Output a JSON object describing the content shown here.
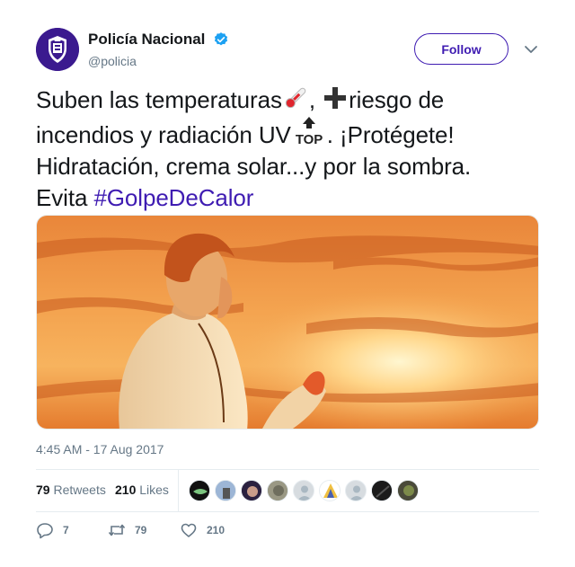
{
  "author": {
    "display_name": "Policía Nacional",
    "handle": "@policia",
    "verified": true
  },
  "follow_label": "Follow",
  "tweet": {
    "line1_a": "Suben las temperaturas",
    "line1_b": ", ",
    "line1_c": "riesgo de",
    "line2_a": "incendios y radiación UV",
    "line2_b": ". ¡Protégete!",
    "line3": "Hidratación, crema solar...y por la sombra.",
    "line4_a": "Evita ",
    "hashtag": "#GolpeDeCalor",
    "emoji": [
      "thermometer-emoji",
      "plus-emoji",
      "top-emoji"
    ]
  },
  "timestamp": "4:45 AM - 17 Aug 2017",
  "stats": {
    "retweets_count": "79",
    "retweets_label": "Retweets",
    "likes_count": "210",
    "likes_label": "Likes"
  },
  "actions": {
    "reply_count": "7",
    "retweet_count": "79",
    "like_count": "210"
  },
  "colors": {
    "brand": "#3f1cb2",
    "verified": "#1da1f2",
    "muted": "#657786",
    "divider": "#e6ecf0"
  }
}
